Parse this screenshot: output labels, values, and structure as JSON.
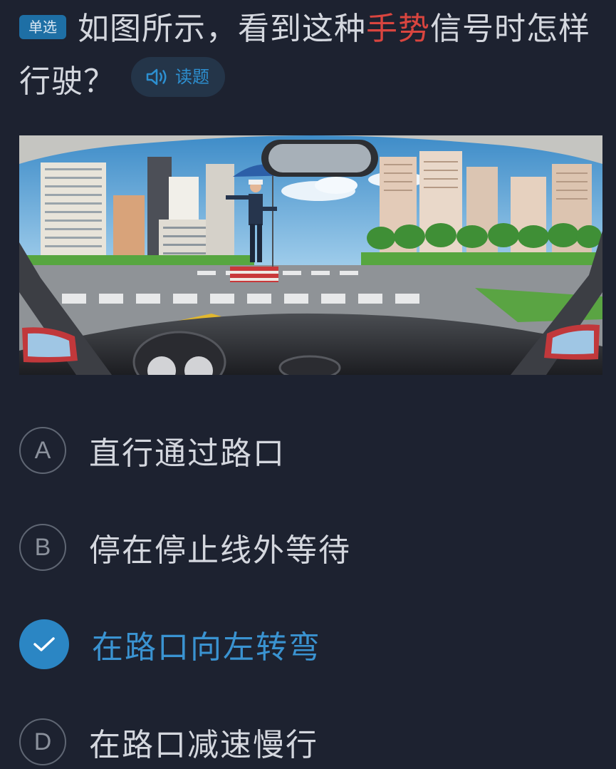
{
  "question": {
    "type_tag": "单选",
    "text_before": "如图所示，看到这种",
    "text_highlight": "手势",
    "text_after": "信号时怎样行驶？",
    "read_button_label": "读题",
    "highlight_color": "#d9453f"
  },
  "options": [
    {
      "letter": "A",
      "text": "直行通过路口",
      "selected": false
    },
    {
      "letter": "B",
      "text": "停在停止线外等待",
      "selected": false
    },
    {
      "letter": "C",
      "text": "在路口向左转弯",
      "selected": true
    },
    {
      "letter": "D",
      "text": "在路口减速慢行",
      "selected": false
    }
  ],
  "colors": {
    "background": "#1d2230",
    "accent": "#2b86c4",
    "correct_text": "#3a93d1"
  }
}
